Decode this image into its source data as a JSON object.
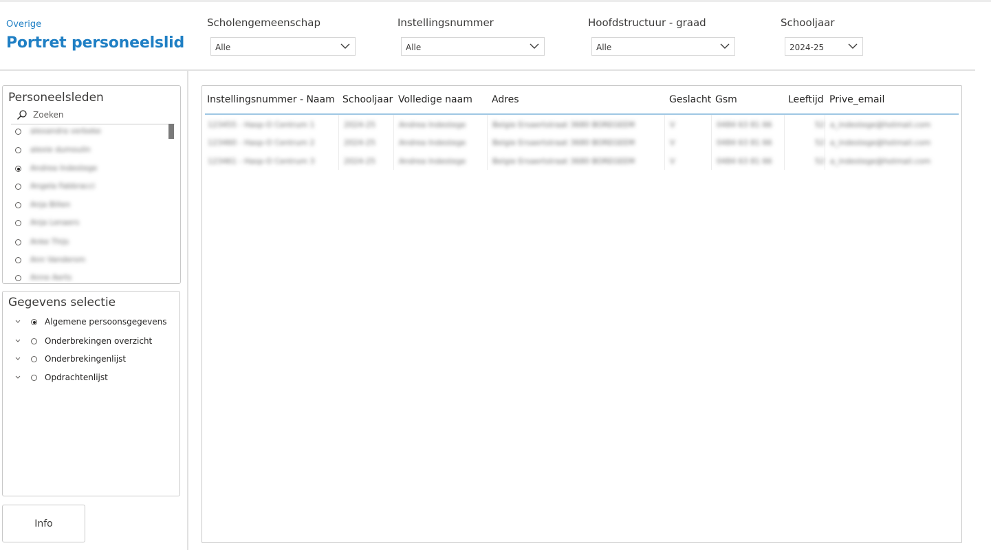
{
  "header": {
    "breadcrumb": "Overige",
    "title": "Portret personeelslid"
  },
  "filters": [
    {
      "label": "Scholengemeenschap",
      "value": "Alle"
    },
    {
      "label": "Instellingsnummer",
      "value": "Alle"
    },
    {
      "label": "Hoofdstructuur - graad",
      "value": "Alle"
    },
    {
      "label": "Schooljaar",
      "value": "2024-25"
    }
  ],
  "personeel": {
    "title": "Personeelsleden",
    "search_placeholder": "Zoeken",
    "items": [
      {
        "label": "alexandra verbeke",
        "selected": false
      },
      {
        "label": "alexie dumoulin",
        "selected": false
      },
      {
        "label": "Andrea Indestege",
        "selected": true
      },
      {
        "label": "Angela Fabbracci",
        "selected": false
      },
      {
        "label": "Anja Billen",
        "selected": false
      },
      {
        "label": "Anja Lenaers",
        "selected": false
      },
      {
        "label": "Anke Thijs",
        "selected": false
      },
      {
        "label": "Ann Vandersm",
        "selected": false
      },
      {
        "label": "Anne Aerts",
        "selected": false
      }
    ]
  },
  "gegevens": {
    "title": "Gegevens selectie",
    "items": [
      {
        "label": "Algemene persoonsgegevens",
        "selected": true
      },
      {
        "label": "Onderbrekingen overzicht",
        "selected": false
      },
      {
        "label": "Onderbrekingenlijst",
        "selected": false
      },
      {
        "label": "Opdrachtenlijst",
        "selected": false
      }
    ]
  },
  "info_button": "Info",
  "table": {
    "columns": [
      "Instellingsnummer - Naam",
      "Schooljaar",
      "Volledige naam",
      "Adres",
      "Geslacht",
      "Gsm",
      "Leeftijd",
      "Prive_email"
    ],
    "rows": [
      [
        "123455 - Hasp-O Centrum 1",
        "2024-25",
        "Andrea Indestege",
        "Belgie Ersaertstraat 3680 BOREGEEM",
        "V",
        "0484 63 81 66",
        "52",
        "a_indestege@hotmail.com"
      ],
      [
        "123460 - Hasp-O Centrum 2",
        "2024-25",
        "Andrea Indestege",
        "Belgie Ersaertstraat 3680 BOREGEEM",
        "V",
        "0484 63 81 66",
        "52",
        "a_indestege@hotmail.com"
      ],
      [
        "123461 - Hasp-O Centrum 3",
        "2024-25",
        "Andrea Indestege",
        "Belgie Ersaertstraat 3680 BOREGEEM",
        "V",
        "0484 63 81 66",
        "52",
        "a_indestege@hotmail.com"
      ]
    ]
  },
  "colors": {
    "accent": "#1f7fc4",
    "header_underline": "#9fc7e3"
  }
}
